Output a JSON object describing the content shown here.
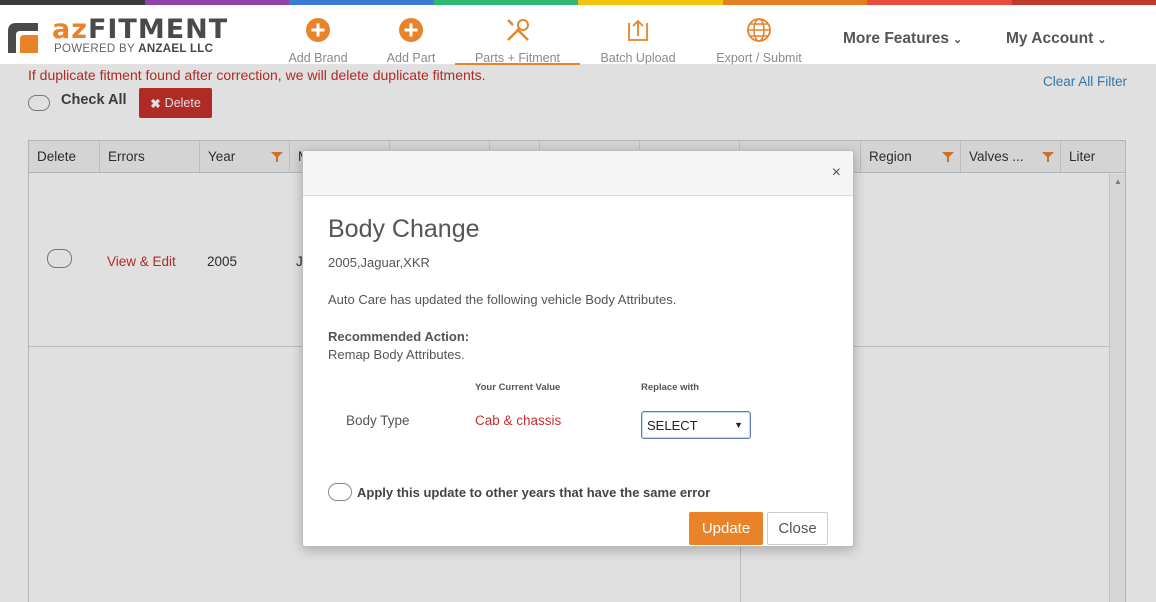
{
  "brand": {
    "name_accent": "az",
    "name_rest": "FITMENT",
    "powered_prefix": "POWERED BY ",
    "powered_company": "ANZAEL LLC",
    "accent_color": "#e8832a"
  },
  "rainbow_colors": [
    "#3a3a3a",
    "#8e44ad",
    "#3a7bd5",
    "#2eb872",
    "#f1c40f",
    "#e67e22",
    "#e74c3c",
    "#c0392b"
  ],
  "nav": {
    "items": [
      {
        "label": "Add Brand",
        "icon": "plus-circle-icon"
      },
      {
        "label": "Add Part",
        "icon": "plus-circle-icon"
      },
      {
        "label": "Parts + Fitment",
        "icon": "tools-icon",
        "active": true
      },
      {
        "label": "Batch Upload",
        "icon": "upload-icon"
      },
      {
        "label": "Export / Submit",
        "icon": "globe-icon"
      }
    ],
    "more_features": "More Features",
    "my_account": "My Account"
  },
  "page": {
    "warning": "If duplicate fitment found after correction, we will delete duplicate fitments.",
    "clear_filter": "Clear All Filter",
    "check_all": "Check All",
    "delete_label": "Delete"
  },
  "grid": {
    "columns": [
      "Delete",
      "Errors",
      "Year",
      "M",
      "",
      "",
      "",
      "",
      "",
      "Region",
      "Valves ...",
      "Liter"
    ],
    "row": {
      "edit_link": "View & Edit",
      "year": "2005",
      "make_partial": "Ja"
    }
  },
  "modal": {
    "title": "Body Change",
    "vehicle": "2005,Jaguar,XKR",
    "description": "Auto Care has updated the following vehicle Body Attributes.",
    "recommended_heading": "Recommended Action:",
    "recommended_text": "Remap Body Attributes.",
    "col_current": "Your Current Value",
    "col_replace": "Replace with",
    "attribute_name": "Body Type",
    "current_value": "Cab & chassis",
    "select_value": "SELECT",
    "apply_label": "Apply this update to other years that have the same error",
    "update_label": "Update",
    "close_label": "Close",
    "close_icon": "×"
  }
}
